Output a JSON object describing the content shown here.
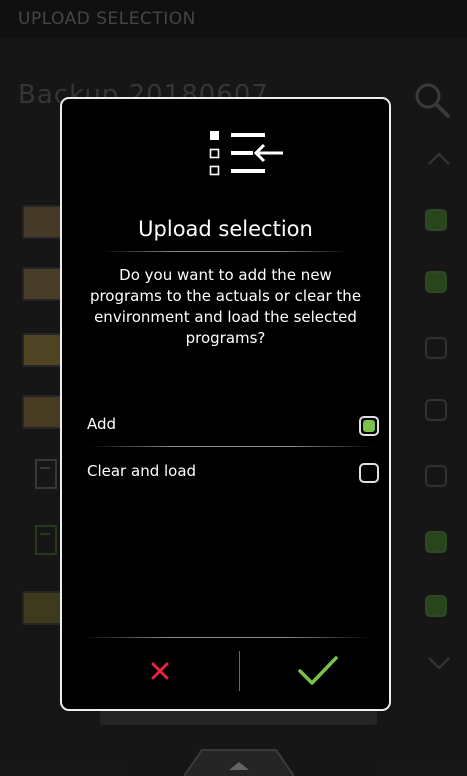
{
  "screen": {
    "title": "UPLOAD SELECTION",
    "backup_name": "Backup 20180607"
  },
  "background_rows": [
    {
      "kind": "photo",
      "checked": true
    },
    {
      "kind": "photo",
      "checked": true
    },
    {
      "kind": "photo",
      "checked": false
    },
    {
      "kind": "photo",
      "checked": false
    },
    {
      "kind": "doc",
      "checked": false
    },
    {
      "kind": "doc",
      "checked": true
    },
    {
      "kind": "photo",
      "checked": true
    }
  ],
  "dialog": {
    "title": "Upload selection",
    "message": "Do you want to add the new programs to the actuals or clear the environment and load the selected programs?",
    "options": [
      {
        "label": "Add",
        "selected": true
      },
      {
        "label": "Clear and load",
        "selected": false
      }
    ],
    "cancel_icon": "close-icon",
    "confirm_icon": "check-icon"
  },
  "colors": {
    "accent_green": "#7ac04a",
    "cancel_red": "#e8243a",
    "confirm_green": "#7ac04a",
    "dialog_border": "#ededed"
  }
}
